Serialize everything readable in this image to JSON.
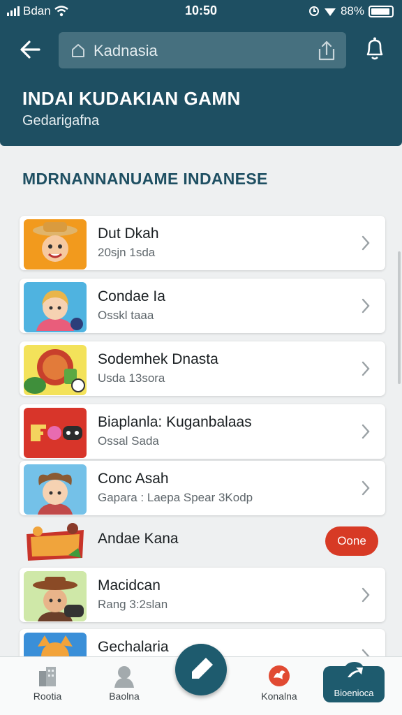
{
  "status": {
    "carrier": "Bdan",
    "time": "10:50",
    "battery": "88%"
  },
  "search": {
    "value": "Kadnasia"
  },
  "header": {
    "title": "INDAI KUDAKIAN GAMN",
    "subtitle": "Gedarigafna"
  },
  "section": {
    "title": "MDRNANNANUAME INDANESE"
  },
  "games": [
    {
      "title": "Dut Dkah",
      "sub": "20sjn 1sda"
    },
    {
      "title": "Condae Ia",
      "sub": "Osskl taaa"
    },
    {
      "title": "Sodemhek Dnasta",
      "sub": "Usda 13sora"
    },
    {
      "title": "Biaplanla: Kuganbalaas",
      "sub": "Ossal Sada"
    },
    {
      "title": "Conc Asah",
      "sub": "Gapara : Laepa Spear 3Kodp"
    },
    {
      "title": "Andae Kana",
      "button": "Oone"
    },
    {
      "title": "Macidcan",
      "sub": "Rang 3:2slan"
    },
    {
      "title": "Gechalaria"
    }
  ],
  "nav": [
    {
      "label": "Rootia",
      "icon": "building-icon"
    },
    {
      "label": "Baolna",
      "icon": "profile-icon"
    },
    {
      "label": "Konalna",
      "icon": "flame-icon"
    },
    {
      "label": "Bioenioca",
      "icon": "cloud-icon"
    }
  ],
  "colors": {
    "header": "#1e4f62",
    "accent": "#d73a25",
    "background": "#eef0f1"
  }
}
